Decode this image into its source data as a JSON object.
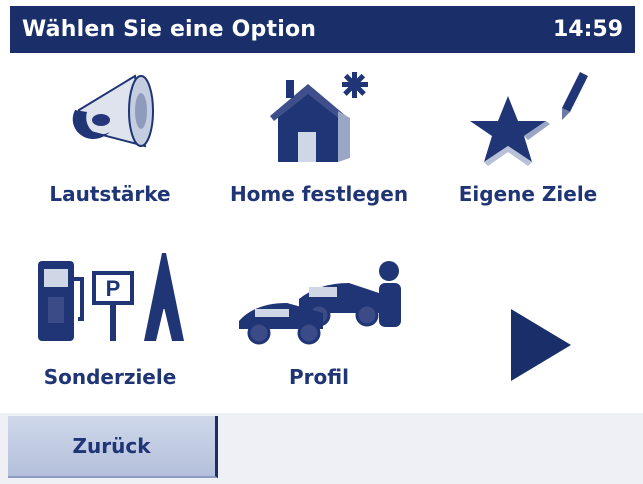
{
  "header": {
    "title": "Wählen Sie eine Option",
    "time": "14:59"
  },
  "options": [
    {
      "label": "Lautstärke",
      "icon": "speaker-icon"
    },
    {
      "label": "Home festlegen",
      "icon": "home-star-icon"
    },
    {
      "label": "Eigene Ziele",
      "icon": "favorites-star-pen-icon"
    },
    {
      "label": "Sonderziele",
      "icon": "poi-icon"
    },
    {
      "label": "Profil",
      "icon": "profile-cars-icon"
    }
  ],
  "footer": {
    "back_label": "Zurück"
  },
  "colors": {
    "accent": "#1a2f6a",
    "label": "#1f3575",
    "background": "#ffffff"
  },
  "next_icon": "play-right-arrow-icon"
}
